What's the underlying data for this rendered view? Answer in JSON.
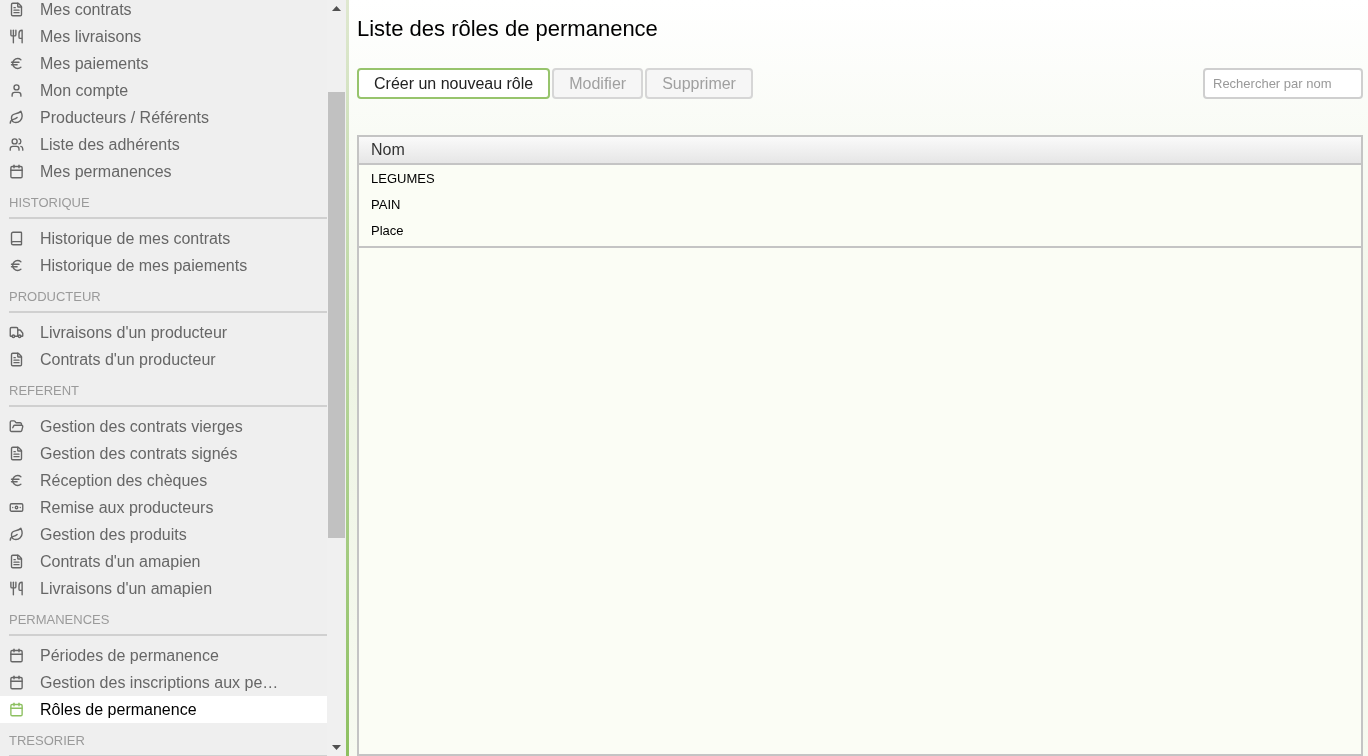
{
  "sidebar": {
    "sections": [
      {
        "items": [
          {
            "kind": "doc",
            "label": "Mes contrats",
            "selected": false
          },
          {
            "kind": "cutlery",
            "label": "Mes livraisons",
            "selected": false
          },
          {
            "kind": "euro",
            "label": "Mes paiements",
            "selected": false
          },
          {
            "kind": "user",
            "label": "Mon compte",
            "selected": false
          },
          {
            "kind": "leaf",
            "label": "Producteurs / Référents",
            "selected": false
          },
          {
            "kind": "users",
            "label": "Liste des adhérents",
            "selected": false
          },
          {
            "kind": "calendar",
            "label": "Mes permanences",
            "selected": false
          }
        ]
      },
      {
        "title": "HISTORIQUE",
        "items": [
          {
            "kind": "book",
            "label": "Historique de mes contrats",
            "selected": false
          },
          {
            "kind": "euro",
            "label": "Historique de mes paiements",
            "selected": false
          }
        ]
      },
      {
        "title": "PRODUCTEUR",
        "items": [
          {
            "kind": "truck",
            "label": "Livraisons d'un producteur",
            "selected": false
          },
          {
            "kind": "doc",
            "label": "Contrats d'un producteur",
            "selected": false
          }
        ]
      },
      {
        "title": "REFERENT",
        "items": [
          {
            "kind": "folder",
            "label": "Gestion des contrats vierges",
            "selected": false
          },
          {
            "kind": "doc",
            "label": "Gestion des contrats signés",
            "selected": false
          },
          {
            "kind": "euro",
            "label": "Réception des chèques",
            "selected": false
          },
          {
            "kind": "money",
            "label": "Remise aux producteurs",
            "selected": false
          },
          {
            "kind": "leaf",
            "label": "Gestion des produits",
            "selected": false
          },
          {
            "kind": "doc",
            "label": "Contrats d'un amapien",
            "selected": false
          },
          {
            "kind": "cutlery",
            "label": "Livraisons d'un amapien",
            "selected": false
          }
        ]
      },
      {
        "title": "PERMANENCES",
        "items": [
          {
            "kind": "calendar",
            "label": "Périodes de permanence",
            "selected": false
          },
          {
            "kind": "calendar",
            "label": "Gestion des inscriptions aux pe…",
            "selected": false
          },
          {
            "kind": "calendar",
            "label": "Rôles de permanence",
            "selected": true
          }
        ]
      },
      {
        "title": "TRESORIER"
      }
    ]
  },
  "page": {
    "title": "Liste des rôles de permanence",
    "buttons": [
      {
        "label": "Créer un nouveau rôle",
        "disabled": false
      },
      {
        "label": "Modifier",
        "disabled": true
      },
      {
        "label": "Supprimer",
        "disabled": true
      }
    ],
    "search": {
      "placeholder": "Rechercher par nom"
    },
    "table": {
      "columns": [
        "Nom"
      ],
      "rows": [
        [
          "LEGUMES"
        ],
        [
          "PAIN"
        ],
        [
          "Place"
        ]
      ]
    }
  }
}
